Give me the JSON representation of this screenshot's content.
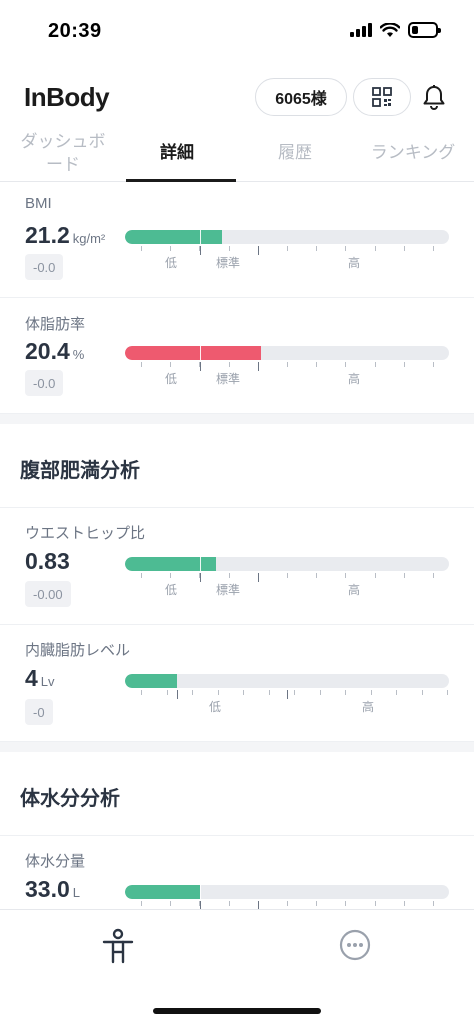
{
  "status": {
    "time": "20:39"
  },
  "header": {
    "logo": "InBody",
    "user_label": "6065様"
  },
  "tabs": [
    {
      "label": "ダッシュボ\nード"
    },
    {
      "label": "詳細"
    },
    {
      "label": "履歴"
    },
    {
      "label": "ランキング"
    }
  ],
  "range_labels": {
    "low": "低",
    "standard": "標準",
    "high": "高"
  },
  "metrics": {
    "bmi": {
      "label": "BMI",
      "value": "21.2",
      "unit": "kg/m²",
      "delta": "-0.0",
      "level": 0.3
    },
    "body_fat": {
      "label": "体脂肪率",
      "value": "20.4",
      "unit": "%",
      "delta": "-0.0",
      "level": 0.42
    },
    "whr": {
      "label": "ウエストヒップ比",
      "value": "0.83",
      "unit": "",
      "delta": "-0.00",
      "level": 0.28
    },
    "visceral": {
      "label": "内臓脂肪レベル",
      "value": "4",
      "unit": "Lv",
      "delta": "-0",
      "level": 0.16
    },
    "water": {
      "label": "体水分量",
      "value": "33.0",
      "unit": "L",
      "delta": "",
      "level": 0.23
    }
  },
  "sections": {
    "abdominal": "腹部肥満分析",
    "body_water": "体水分分析"
  },
  "icons": {
    "qr": "qr-code-icon",
    "bell": "bell-icon",
    "body": "body-icon",
    "more": "more-icon"
  },
  "colors": {
    "green": "#4dbb93",
    "red": "#ee5a6f",
    "track": "#e9ebef"
  }
}
